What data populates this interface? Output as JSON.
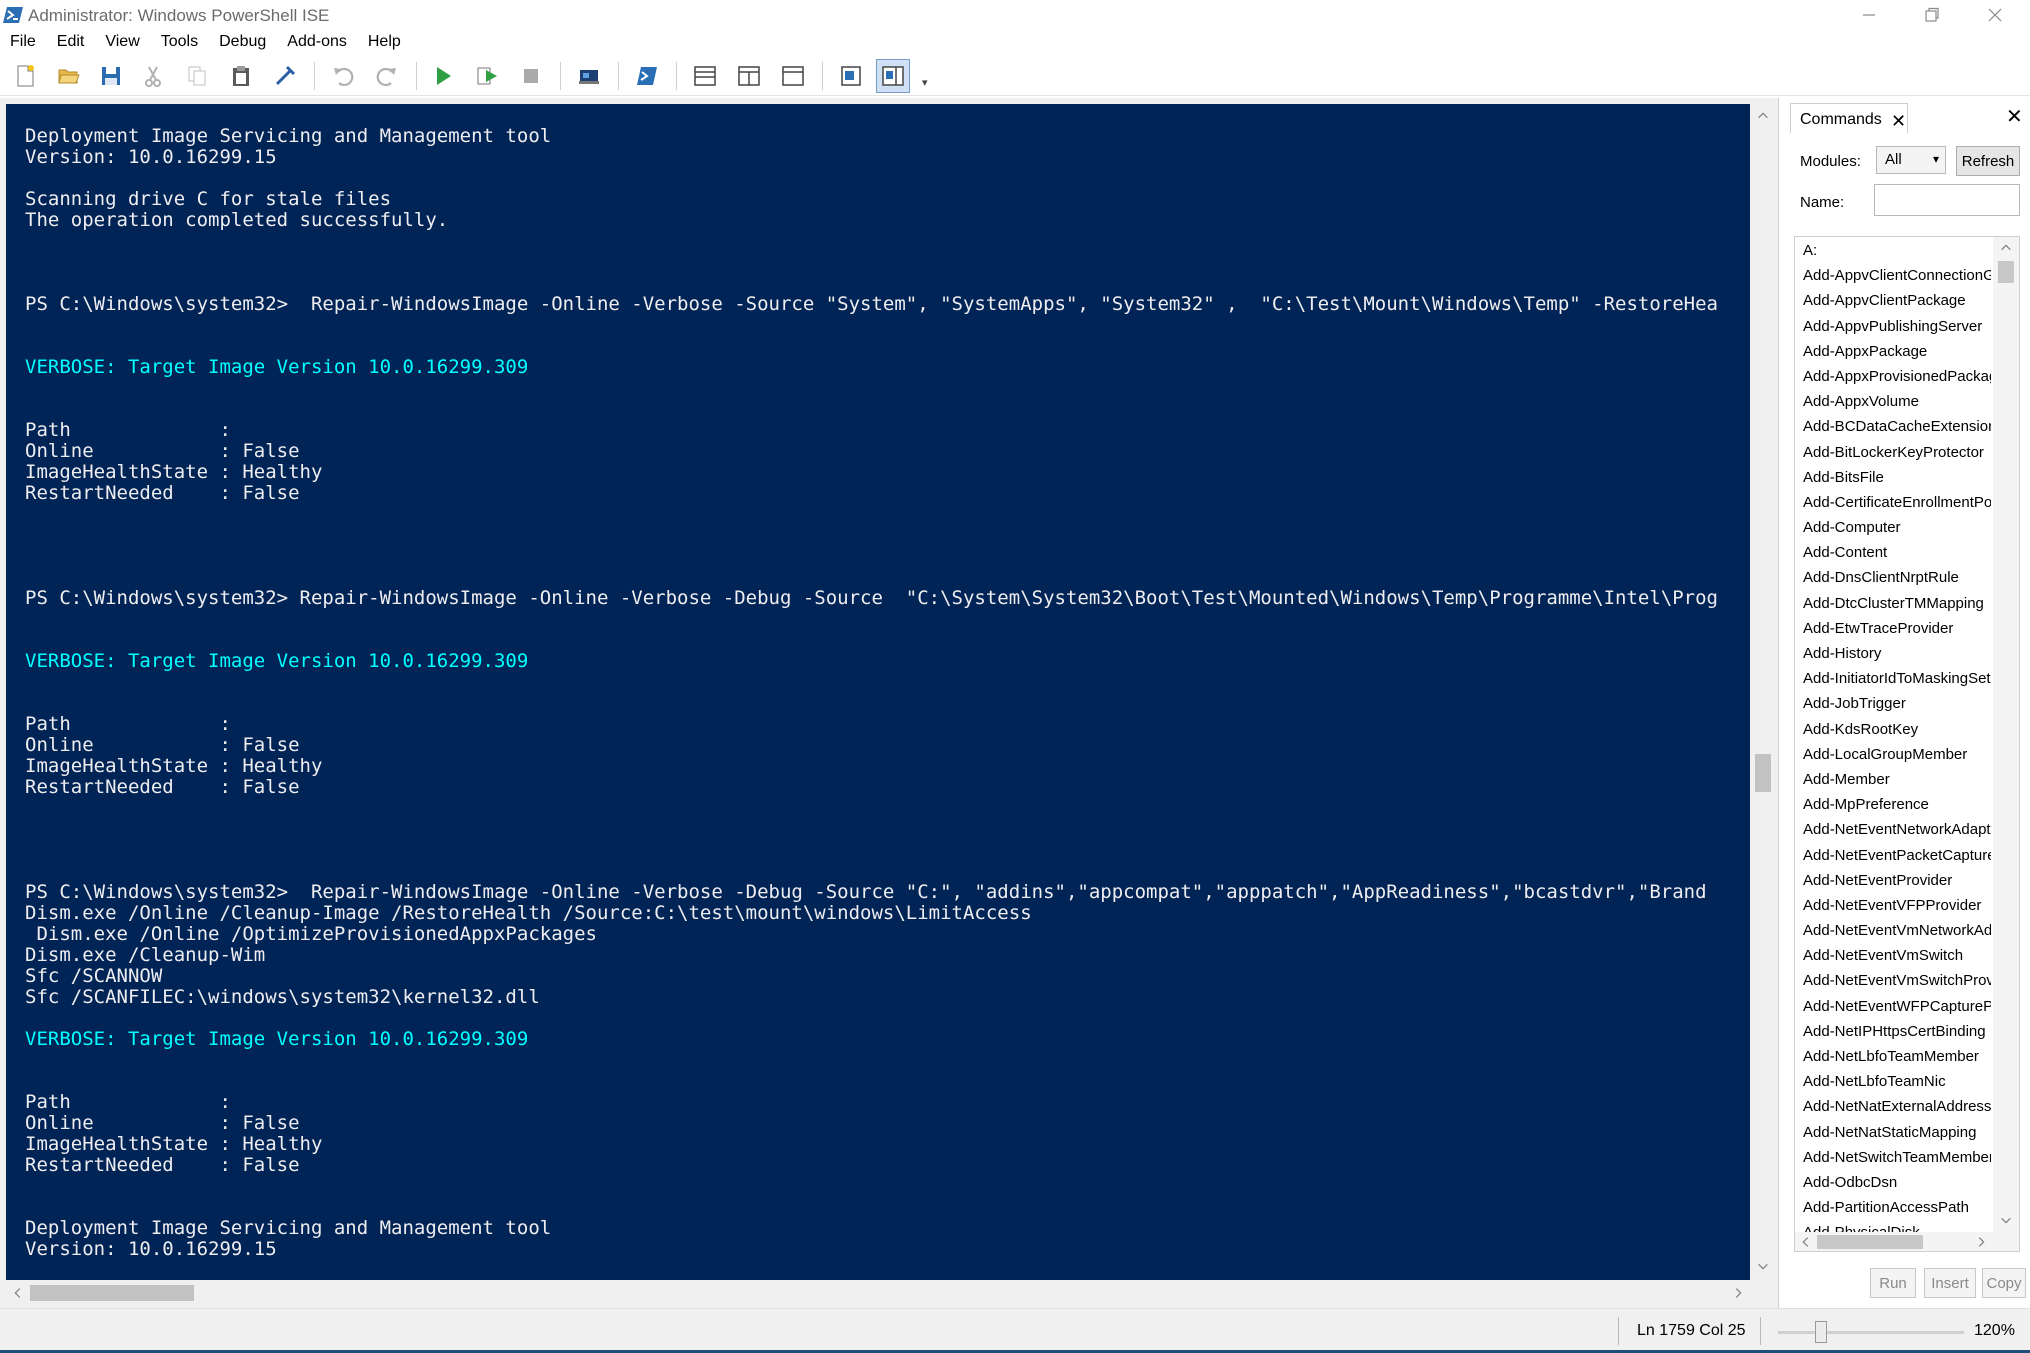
{
  "window": {
    "title": "Administrator: Windows PowerShell ISE",
    "icon": "powershell-icon",
    "controls": [
      "minimize-icon",
      "restore-icon",
      "close-icon"
    ]
  },
  "menu": {
    "items": [
      "File",
      "Edit",
      "View",
      "Tools",
      "Debug",
      "Add-ons",
      "Help"
    ]
  },
  "toolbar": {
    "buttons": [
      "new-file-icon",
      "open-folder-icon",
      "save-icon",
      "cut-icon",
      "copy-icon",
      "paste-icon",
      "clear-console-icon",
      "undo-icon",
      "redo-icon",
      "run-icon",
      "run-selection-icon",
      "stop-icon",
      "remote-powershell-icon",
      "start-powershell-icon",
      "script-pane-top-icon",
      "script-pane-right-icon",
      "script-pane-maximized-icon",
      "show-script-pane-icon",
      "show-command-addon-icon"
    ]
  },
  "console": {
    "colors": {
      "background": "#012456",
      "text": "#eeedf0",
      "verbose": "#00ffff"
    },
    "lines": [
      {
        "text": "Deployment Image Servicing and Management tool",
        "type": "normal"
      },
      {
        "text": "Version: 10.0.16299.15",
        "type": "normal"
      },
      {
        "text": "",
        "type": "normal"
      },
      {
        "text": "Scanning drive C for stale files",
        "type": "normal"
      },
      {
        "text": "The operation completed successfully.",
        "type": "normal"
      },
      {
        "text": "",
        "type": "normal"
      },
      {
        "text": "",
        "type": "normal"
      },
      {
        "text": "",
        "type": "normal"
      },
      {
        "text": "PS C:\\Windows\\system32>  Repair-WindowsImage -Online -Verbose -Source \"System\", \"SystemApps\", \"System32\" ,  \"C:\\Test\\Mount\\Windows\\Temp\" -RestoreHea",
        "type": "normal"
      },
      {
        "text": "",
        "type": "normal"
      },
      {
        "text": "",
        "type": "normal"
      },
      {
        "text": "VERBOSE: Target Image Version 10.0.16299.309",
        "type": "verbose"
      },
      {
        "text": "",
        "type": "normal"
      },
      {
        "text": "",
        "type": "normal"
      },
      {
        "text": "Path             :",
        "type": "normal"
      },
      {
        "text": "Online           : False",
        "type": "normal"
      },
      {
        "text": "ImageHealthState : Healthy",
        "type": "normal"
      },
      {
        "text": "RestartNeeded    : False",
        "type": "normal"
      },
      {
        "text": "",
        "type": "normal"
      },
      {
        "text": "",
        "type": "normal"
      },
      {
        "text": "",
        "type": "normal"
      },
      {
        "text": "",
        "type": "normal"
      },
      {
        "text": "PS C:\\Windows\\system32> Repair-WindowsImage -Online -Verbose -Debug -Source  \"C:\\System\\System32\\Boot\\Test\\Mounted\\Windows\\Temp\\Programme\\Intel\\Prog",
        "type": "normal"
      },
      {
        "text": "",
        "type": "normal"
      },
      {
        "text": "",
        "type": "normal"
      },
      {
        "text": "VERBOSE: Target Image Version 10.0.16299.309",
        "type": "verbose"
      },
      {
        "text": "",
        "type": "normal"
      },
      {
        "text": "",
        "type": "normal"
      },
      {
        "text": "Path             :",
        "type": "normal"
      },
      {
        "text": "Online           : False",
        "type": "normal"
      },
      {
        "text": "ImageHealthState : Healthy",
        "type": "normal"
      },
      {
        "text": "RestartNeeded    : False",
        "type": "normal"
      },
      {
        "text": "",
        "type": "normal"
      },
      {
        "text": "",
        "type": "normal"
      },
      {
        "text": "",
        "type": "normal"
      },
      {
        "text": "",
        "type": "normal"
      },
      {
        "text": "PS C:\\Windows\\system32>  Repair-WindowsImage -Online -Verbose -Debug -Source \"C:\", \"addins\",\"appcompat\",\"apppatch\",\"AppReadiness\",\"bcastdvr\",\"Brand",
        "type": "normal"
      },
      {
        "text": "Dism.exe /Online /Cleanup-Image /RestoreHealth /Source:C:\\test\\mount\\windows\\LimitAccess",
        "type": "normal"
      },
      {
        "text": " Dism.exe /Online /OptimizeProvisionedAppxPackages",
        "type": "normal"
      },
      {
        "text": "Dism.exe /Cleanup-Wim",
        "type": "normal"
      },
      {
        "text": "Sfc /SCANNOW",
        "type": "normal"
      },
      {
        "text": "Sfc /SCANFILEC:\\windows\\system32\\kernel32.dll",
        "type": "normal"
      },
      {
        "text": "",
        "type": "normal"
      },
      {
        "text": "VERBOSE: Target Image Version 10.0.16299.309",
        "type": "verbose"
      },
      {
        "text": "",
        "type": "normal"
      },
      {
        "text": "",
        "type": "normal"
      },
      {
        "text": "Path             :",
        "type": "normal"
      },
      {
        "text": "Online           : False",
        "type": "normal"
      },
      {
        "text": "ImageHealthState : Healthy",
        "type": "normal"
      },
      {
        "text": "RestartNeeded    : False",
        "type": "normal"
      },
      {
        "text": "",
        "type": "normal"
      },
      {
        "text": "",
        "type": "normal"
      },
      {
        "text": "Deployment Image Servicing and Management tool",
        "type": "normal"
      },
      {
        "text": "Version: 10.0.16299.15",
        "type": "normal"
      }
    ]
  },
  "commands_pane": {
    "tab_label": "Commands",
    "modules_label": "Modules:",
    "modules_value": "All",
    "refresh_label": "Refresh",
    "name_label": "Name:",
    "name_value": "",
    "items": [
      "A:",
      "Add-AppvClientConnectionGroup",
      "Add-AppvClientPackage",
      "Add-AppvPublishingServer",
      "Add-AppxPackage",
      "Add-AppxProvisionedPackage",
      "Add-AppxVolume",
      "Add-BCDataCacheExtension",
      "Add-BitLockerKeyProtector",
      "Add-BitsFile",
      "Add-CertificateEnrollmentPolicyServer",
      "Add-Computer",
      "Add-Content",
      "Add-DnsClientNrptRule",
      "Add-DtcClusterTMMapping",
      "Add-EtwTraceProvider",
      "Add-History",
      "Add-InitiatorIdToMaskingSet",
      "Add-JobTrigger",
      "Add-KdsRootKey",
      "Add-LocalGroupMember",
      "Add-Member",
      "Add-MpPreference",
      "Add-NetEventNetworkAdapter",
      "Add-NetEventPacketCaptureProvider",
      "Add-NetEventProvider",
      "Add-NetEventVFPProvider",
      "Add-NetEventVmNetworkAdapter",
      "Add-NetEventVmSwitch",
      "Add-NetEventVmSwitchProvider",
      "Add-NetEventWFPCaptureProvider",
      "Add-NetIPHttpsCertBinding",
      "Add-NetLbfoTeamMember",
      "Add-NetLbfoTeamNic",
      "Add-NetNatExternalAddress",
      "Add-NetNatStaticMapping",
      "Add-NetSwitchTeamMember",
      "Add-OdbcDsn",
      "Add-PartitionAccessPath",
      "Add-PhysicalDisk"
    ],
    "run_label": "Run",
    "insert_label": "Insert",
    "copy_label": "Copy"
  },
  "status": {
    "position": "Ln 1759  Col 25",
    "zoom": "120%",
    "zoom_fraction": 0.2
  }
}
